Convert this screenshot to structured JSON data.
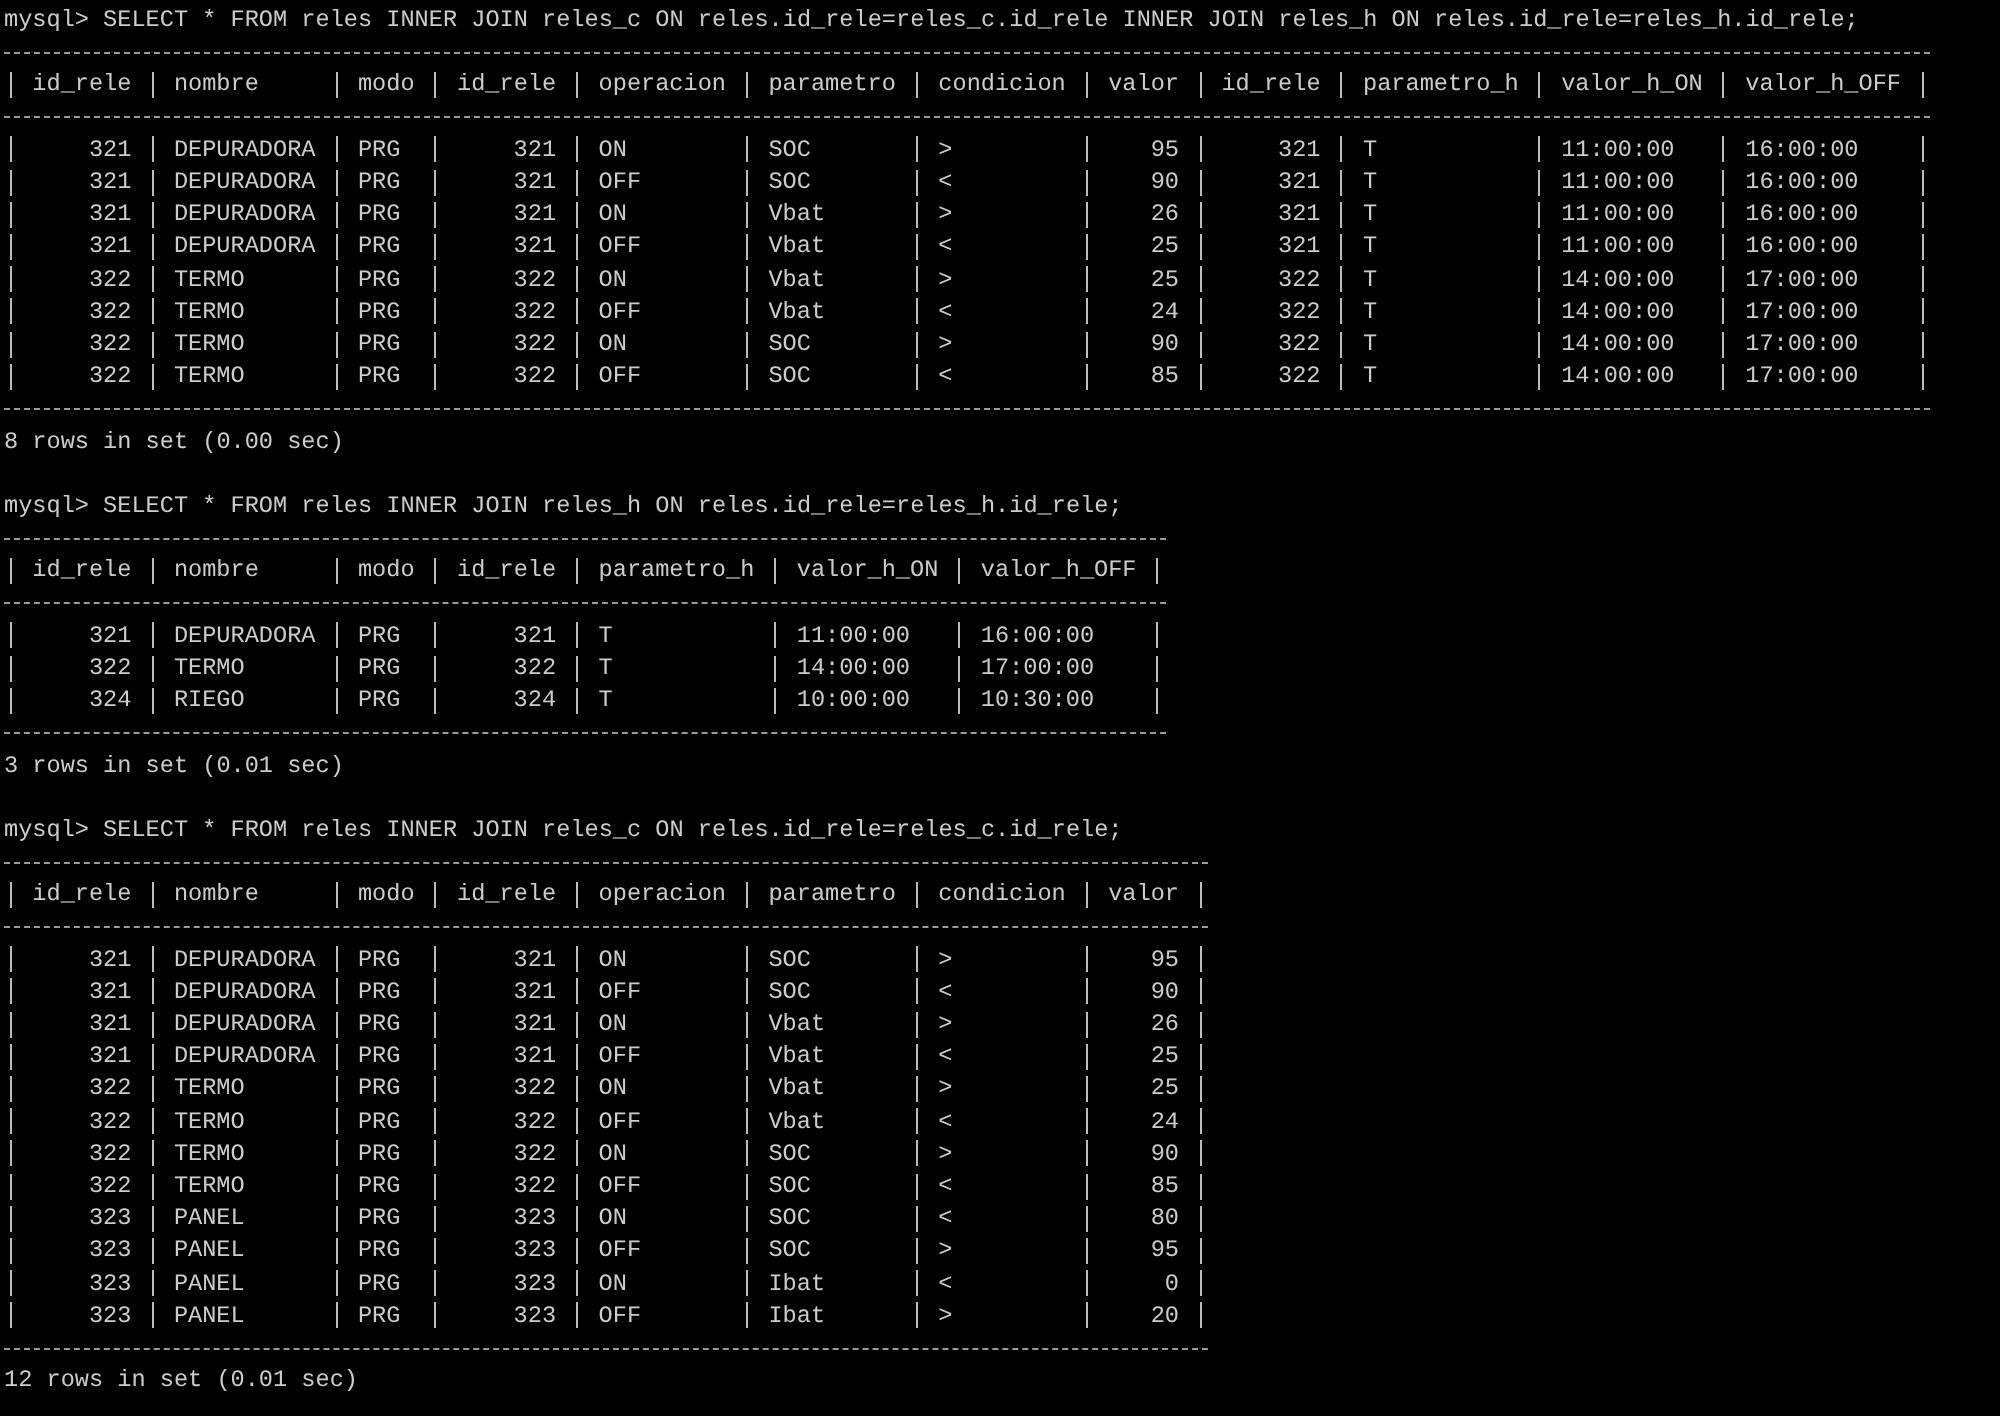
{
  "blocks": [
    {
      "command": "mysql> SELECT * FROM reles INNER JOIN reles_c ON reles.id_rele=reles_c.id_rele INNER JOIN reles_h ON reles.id_rele=reles_h.id_rele;",
      "columns": [
        {
          "label": "id_rele",
          "right_aligned": true
        },
        {
          "label": "nombre",
          "right_aligned": false
        },
        {
          "label": "modo",
          "right_aligned": false
        },
        {
          "label": "id_rele",
          "right_aligned": true
        },
        {
          "label": "operacion",
          "right_aligned": false
        },
        {
          "label": "parametro",
          "right_aligned": false
        },
        {
          "label": "condicion",
          "right_aligned": false
        },
        {
          "label": "valor",
          "right_aligned": true
        },
        {
          "label": "id_rele",
          "right_aligned": true
        },
        {
          "label": "parametro_h",
          "right_aligned": false
        },
        {
          "label": "valor_h_ON",
          "right_aligned": false
        },
        {
          "label": "valor_h_OFF",
          "right_aligned": false
        }
      ],
      "rows": [
        [
          "321",
          "DEPURADORA",
          "PRG",
          "321",
          "ON",
          "SOC",
          ">",
          "95",
          "321",
          "T",
          "11:00:00",
          "16:00:00"
        ],
        [
          "321",
          "DEPURADORA",
          "PRG",
          "321",
          "OFF",
          "SOC",
          "<",
          "90",
          "321",
          "T",
          "11:00:00",
          "16:00:00"
        ],
        [
          "321",
          "DEPURADORA",
          "PRG",
          "321",
          "ON",
          "Vbat",
          ">",
          "26",
          "321",
          "T",
          "11:00:00",
          "16:00:00"
        ],
        [
          "321",
          "DEPURADORA",
          "PRG",
          "321",
          "OFF",
          "Vbat",
          "<",
          "25",
          "321",
          "T",
          "11:00:00",
          "16:00:00"
        ],
        [
          "322",
          "TERMO",
          "PRG",
          "322",
          "ON",
          "Vbat",
          ">",
          "25",
          "322",
          "T",
          "14:00:00",
          "17:00:00"
        ],
        [
          "322",
          "TERMO",
          "PRG",
          "322",
          "OFF",
          "Vbat",
          "<",
          "24",
          "322",
          "T",
          "14:00:00",
          "17:00:00"
        ],
        [
          "322",
          "TERMO",
          "PRG",
          "322",
          "ON",
          "SOC",
          ">",
          "90",
          "322",
          "T",
          "14:00:00",
          "17:00:00"
        ],
        [
          "322",
          "TERMO",
          "PRG",
          "322",
          "OFF",
          "SOC",
          "<",
          "85",
          "322",
          "T",
          "14:00:00",
          "17:00:00"
        ]
      ],
      "summary": "8 rows in set (0.00 sec)"
    },
    {
      "command": "mysql> SELECT * FROM reles INNER JOIN reles_h ON reles.id_rele=reles_h.id_rele;",
      "columns": [
        {
          "label": "id_rele",
          "right_aligned": true
        },
        {
          "label": "nombre",
          "right_aligned": false
        },
        {
          "label": "modo",
          "right_aligned": false
        },
        {
          "label": "id_rele",
          "right_aligned": true
        },
        {
          "label": "parametro_h",
          "right_aligned": false
        },
        {
          "label": "valor_h_ON",
          "right_aligned": false
        },
        {
          "label": "valor_h_OFF",
          "right_aligned": false
        }
      ],
      "rows": [
        [
          "321",
          "DEPURADORA",
          "PRG",
          "321",
          "T",
          "11:00:00",
          "16:00:00"
        ],
        [
          "322",
          "TERMO",
          "PRG",
          "322",
          "T",
          "14:00:00",
          "17:00:00"
        ],
        [
          "324",
          "RIEGO",
          "PRG",
          "324",
          "T",
          "10:00:00",
          "10:30:00"
        ]
      ],
      "summary": "3 rows in set (0.01 sec)"
    },
    {
      "command": "mysql> SELECT * FROM reles INNER JOIN reles_c ON reles.id_rele=reles_c.id_rele;",
      "columns": [
        {
          "label": "id_rele",
          "right_aligned": true
        },
        {
          "label": "nombre",
          "right_aligned": false
        },
        {
          "label": "modo",
          "right_aligned": false
        },
        {
          "label": "id_rele",
          "right_aligned": true
        },
        {
          "label": "operacion",
          "right_aligned": false
        },
        {
          "label": "parametro",
          "right_aligned": false
        },
        {
          "label": "condicion",
          "right_aligned": false
        },
        {
          "label": "valor",
          "right_aligned": true
        }
      ],
      "rows": [
        [
          "321",
          "DEPURADORA",
          "PRG",
          "321",
          "ON",
          "SOC",
          ">",
          "95"
        ],
        [
          "321",
          "DEPURADORA",
          "PRG",
          "321",
          "OFF",
          "SOC",
          "<",
          "90"
        ],
        [
          "321",
          "DEPURADORA",
          "PRG",
          "321",
          "ON",
          "Vbat",
          ">",
          "26"
        ],
        [
          "321",
          "DEPURADORA",
          "PRG",
          "321",
          "OFF",
          "Vbat",
          "<",
          "25"
        ],
        [
          "322",
          "TERMO",
          "PRG",
          "322",
          "ON",
          "Vbat",
          ">",
          "25"
        ],
        [
          "322",
          "TERMO",
          "PRG",
          "322",
          "OFF",
          "Vbat",
          "<",
          "24"
        ],
        [
          "322",
          "TERMO",
          "PRG",
          "322",
          "ON",
          "SOC",
          ">",
          "90"
        ],
        [
          "322",
          "TERMO",
          "PRG",
          "322",
          "OFF",
          "SOC",
          "<",
          "85"
        ],
        [
          "323",
          "PANEL",
          "PRG",
          "323",
          "ON",
          "SOC",
          "<",
          "80"
        ],
        [
          "323",
          "PANEL",
          "PRG",
          "323",
          "OFF",
          "SOC",
          ">",
          "95"
        ],
        [
          "323",
          "PANEL",
          "PRG",
          "323",
          "ON",
          "Ibat",
          "<",
          "0"
        ],
        [
          "323",
          "PANEL",
          "PRG",
          "323",
          "OFF",
          "Ibat",
          ">",
          "20"
        ]
      ],
      "summary": "12 rows in set (0.01 sec)"
    }
  ]
}
